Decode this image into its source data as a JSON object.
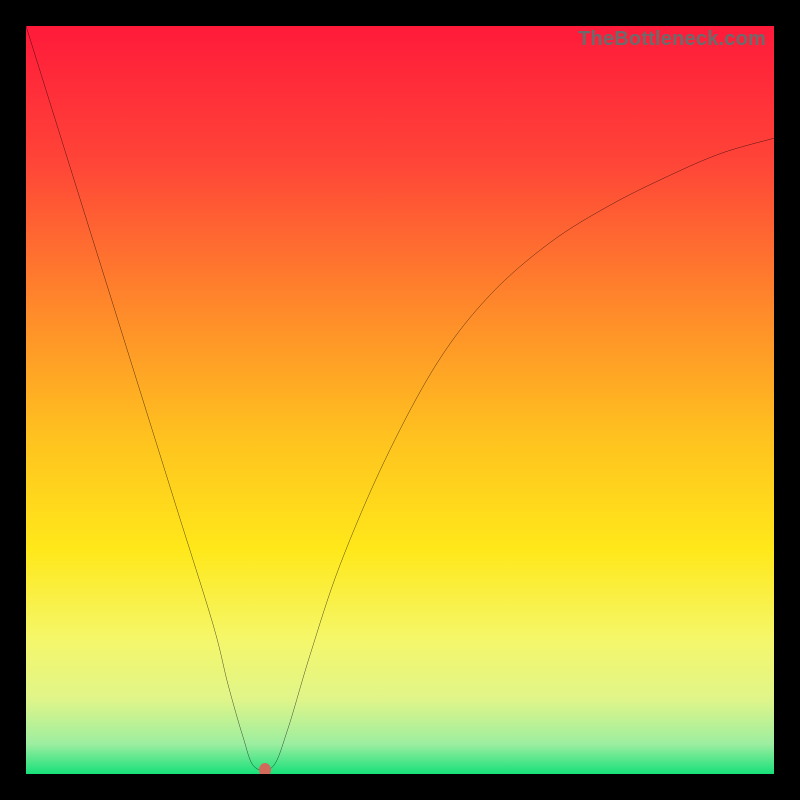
{
  "watermark": "TheBottleneck.com",
  "chart_data": {
    "type": "line",
    "title": "",
    "xlabel": "",
    "ylabel": "",
    "xlim": [
      0,
      100
    ],
    "ylim": [
      0,
      100
    ],
    "grid": false,
    "legend": false,
    "series": [
      {
        "name": "curve",
        "color": "#000000",
        "x": [
          0,
          5,
          10,
          15,
          20,
          25,
          27,
          29,
          30.5,
          33,
          35,
          38,
          42,
          48,
          55,
          62,
          70,
          78,
          86,
          93,
          100
        ],
        "y": [
          100,
          84,
          68,
          52,
          36,
          20,
          12,
          5,
          1,
          1,
          6,
          16,
          28,
          42,
          55,
          64,
          71,
          76,
          80,
          83,
          85
        ]
      }
    ],
    "marker": {
      "x": 32,
      "y": 0.5,
      "color": "#d16a5a"
    },
    "gradient_stops": [
      {
        "pos": 0.0,
        "color": "#ff1a3a"
      },
      {
        "pos": 0.18,
        "color": "#ff4438"
      },
      {
        "pos": 0.38,
        "color": "#ff8a2a"
      },
      {
        "pos": 0.55,
        "color": "#ffc21f"
      },
      {
        "pos": 0.7,
        "color": "#ffe81a"
      },
      {
        "pos": 0.82,
        "color": "#f5f76a"
      },
      {
        "pos": 0.9,
        "color": "#e0f589"
      },
      {
        "pos": 0.96,
        "color": "#9ceea0"
      },
      {
        "pos": 1.0,
        "color": "#18e07a"
      }
    ]
  }
}
